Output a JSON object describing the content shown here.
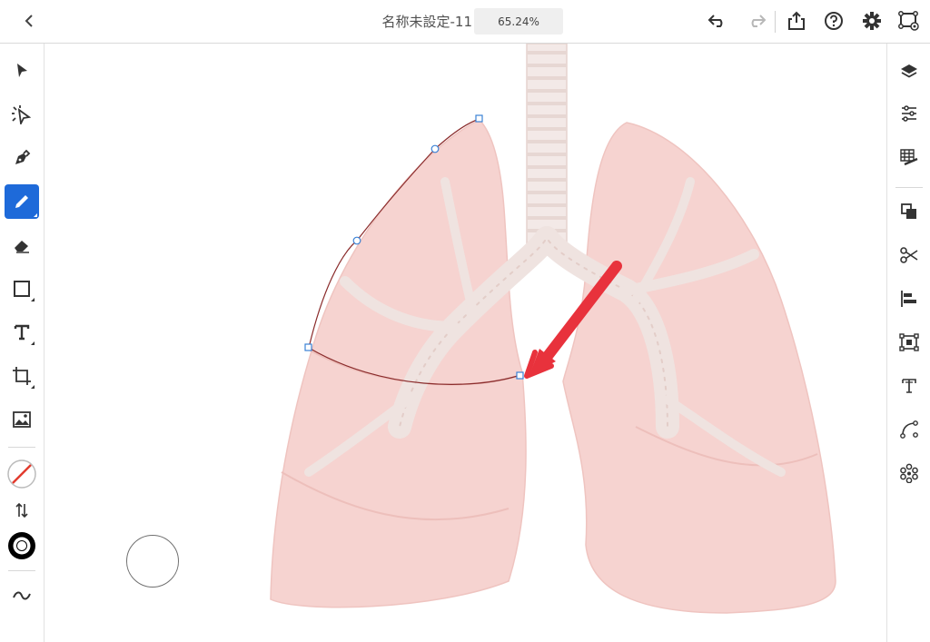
{
  "topbar": {
    "document_title": "名称未設定-11",
    "zoom_level": "65.24%",
    "icons": [
      "chevron-left-icon",
      "undo-icon",
      "redo-icon",
      "share-icon",
      "help-icon",
      "gear-icon",
      "cloud-doc-icon"
    ]
  },
  "left_toolbar": {
    "tools": [
      "select-icon",
      "direct-select-icon",
      "pen-icon",
      "pencil-icon",
      "eraser-icon",
      "rectangle-icon",
      "type-icon",
      "place-icon",
      "image-icon"
    ],
    "active_tool": "pencil-icon",
    "fill": "none",
    "stroke_color": "#000000",
    "swap_icon": "swap-arrows-icon",
    "smooth_icon": "tilde-icon"
  },
  "right_toolbar": {
    "tools": [
      "layers-icon",
      "properties-icon",
      "grid-icon",
      "arrange-icon",
      "scissors-icon",
      "align-icon",
      "crop-icon",
      "type-panel-icon",
      "path-icon",
      "repeat-icon"
    ]
  },
  "canvas": {
    "artwork": "lungs-illustration",
    "lung_color": "#f6d3d0",
    "path_color": "#8a2b2b",
    "arrow_color": "#e8323c",
    "anchor_color": "#3b82d6"
  }
}
